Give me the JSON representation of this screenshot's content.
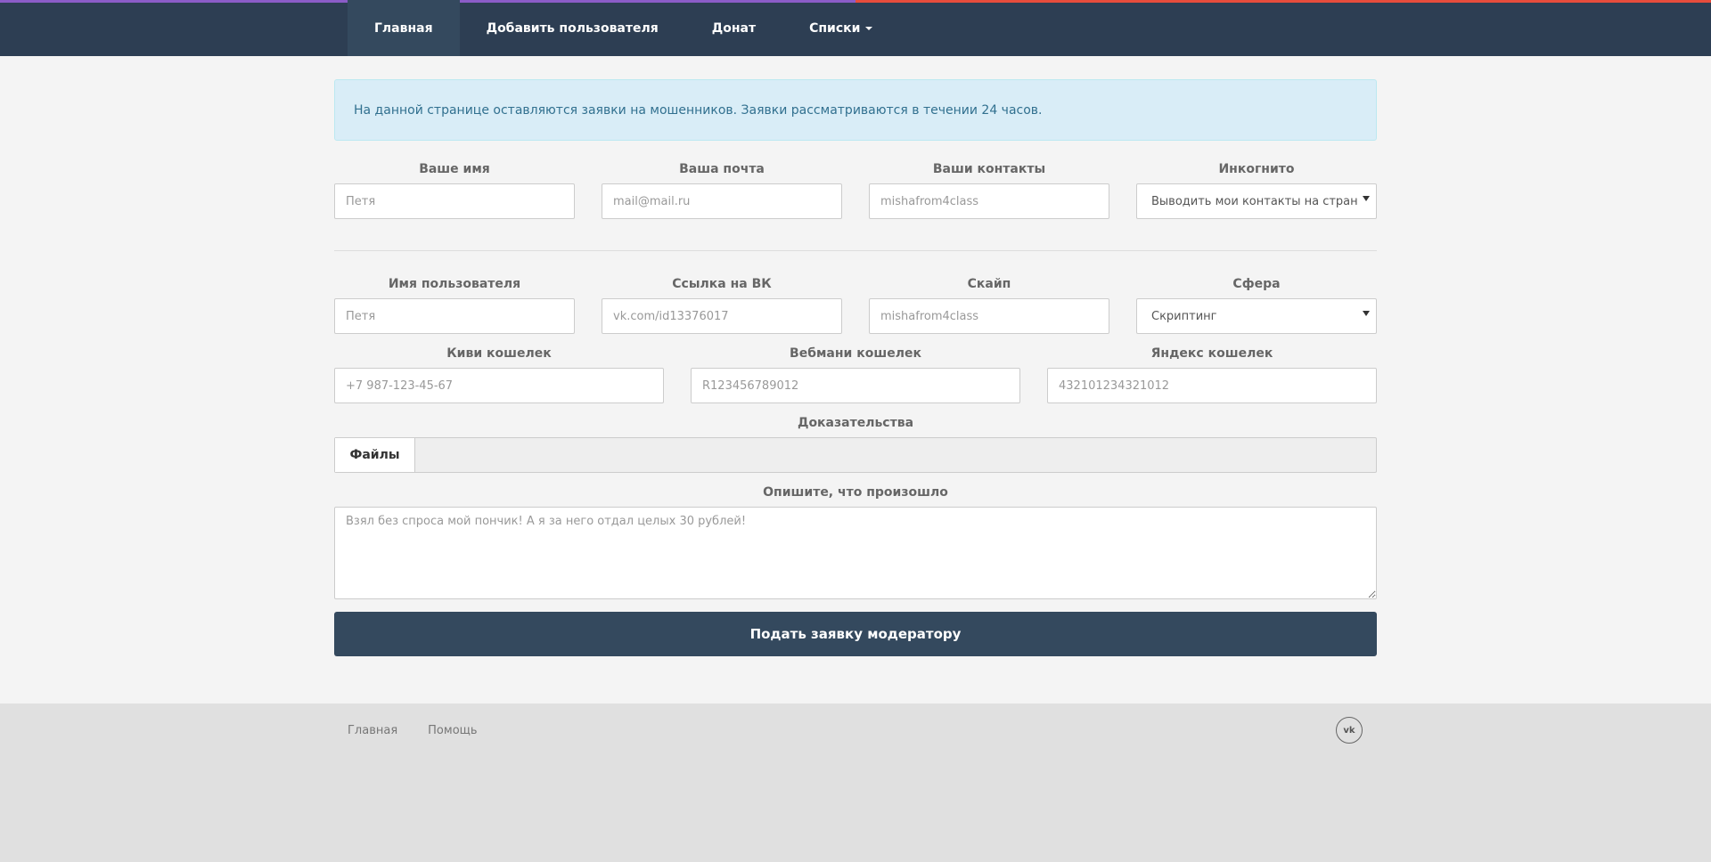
{
  "nav": {
    "items": [
      {
        "label": "Главная",
        "active": true
      },
      {
        "label": "Добавить пользователя"
      },
      {
        "label": "Донат"
      },
      {
        "label": "Списки",
        "dropdown": true
      }
    ]
  },
  "alert": {
    "text": "На данной странице оставляются заявки на мошенников. Заявки рассматриваются в течении 24 часов."
  },
  "reporter": {
    "name": {
      "label": "Ваше имя",
      "placeholder": "Петя"
    },
    "email": {
      "label": "Ваша почта",
      "placeholder": "mail@mail.ru"
    },
    "contacts": {
      "label": "Ваши контакты",
      "placeholder": "mishafrom4class"
    },
    "incognito": {
      "label": "Инкогнито",
      "value": "Выводить мои контакты на стран"
    }
  },
  "target": {
    "username": {
      "label": "Имя пользователя",
      "placeholder": "Петя"
    },
    "vk": {
      "label": "Ссылка на ВК",
      "placeholder": "vk.com/id13376017"
    },
    "skype": {
      "label": "Скайп",
      "placeholder": "mishafrom4class"
    },
    "sphere": {
      "label": "Сфера",
      "value": "Скриптинг"
    }
  },
  "wallets": {
    "qiwi": {
      "label": "Киви кошелек",
      "placeholder": "+7 987-123-45-67"
    },
    "webmoney": {
      "label": "Вебмани кошелек",
      "placeholder": "R123456789012"
    },
    "yandex": {
      "label": "Яндекс кошелек",
      "placeholder": "432101234321012"
    }
  },
  "evidence": {
    "label": "Доказательства",
    "button": "Файлы"
  },
  "description": {
    "label": "Опишите, что произошло",
    "placeholder": "Взял без спроса мой пончик! А я за него отдал целых 30 рублей!"
  },
  "submit": {
    "label": "Подать заявку модератору"
  },
  "footer": {
    "links": [
      "Главная",
      "Помощь"
    ],
    "vk_label": "vk"
  }
}
